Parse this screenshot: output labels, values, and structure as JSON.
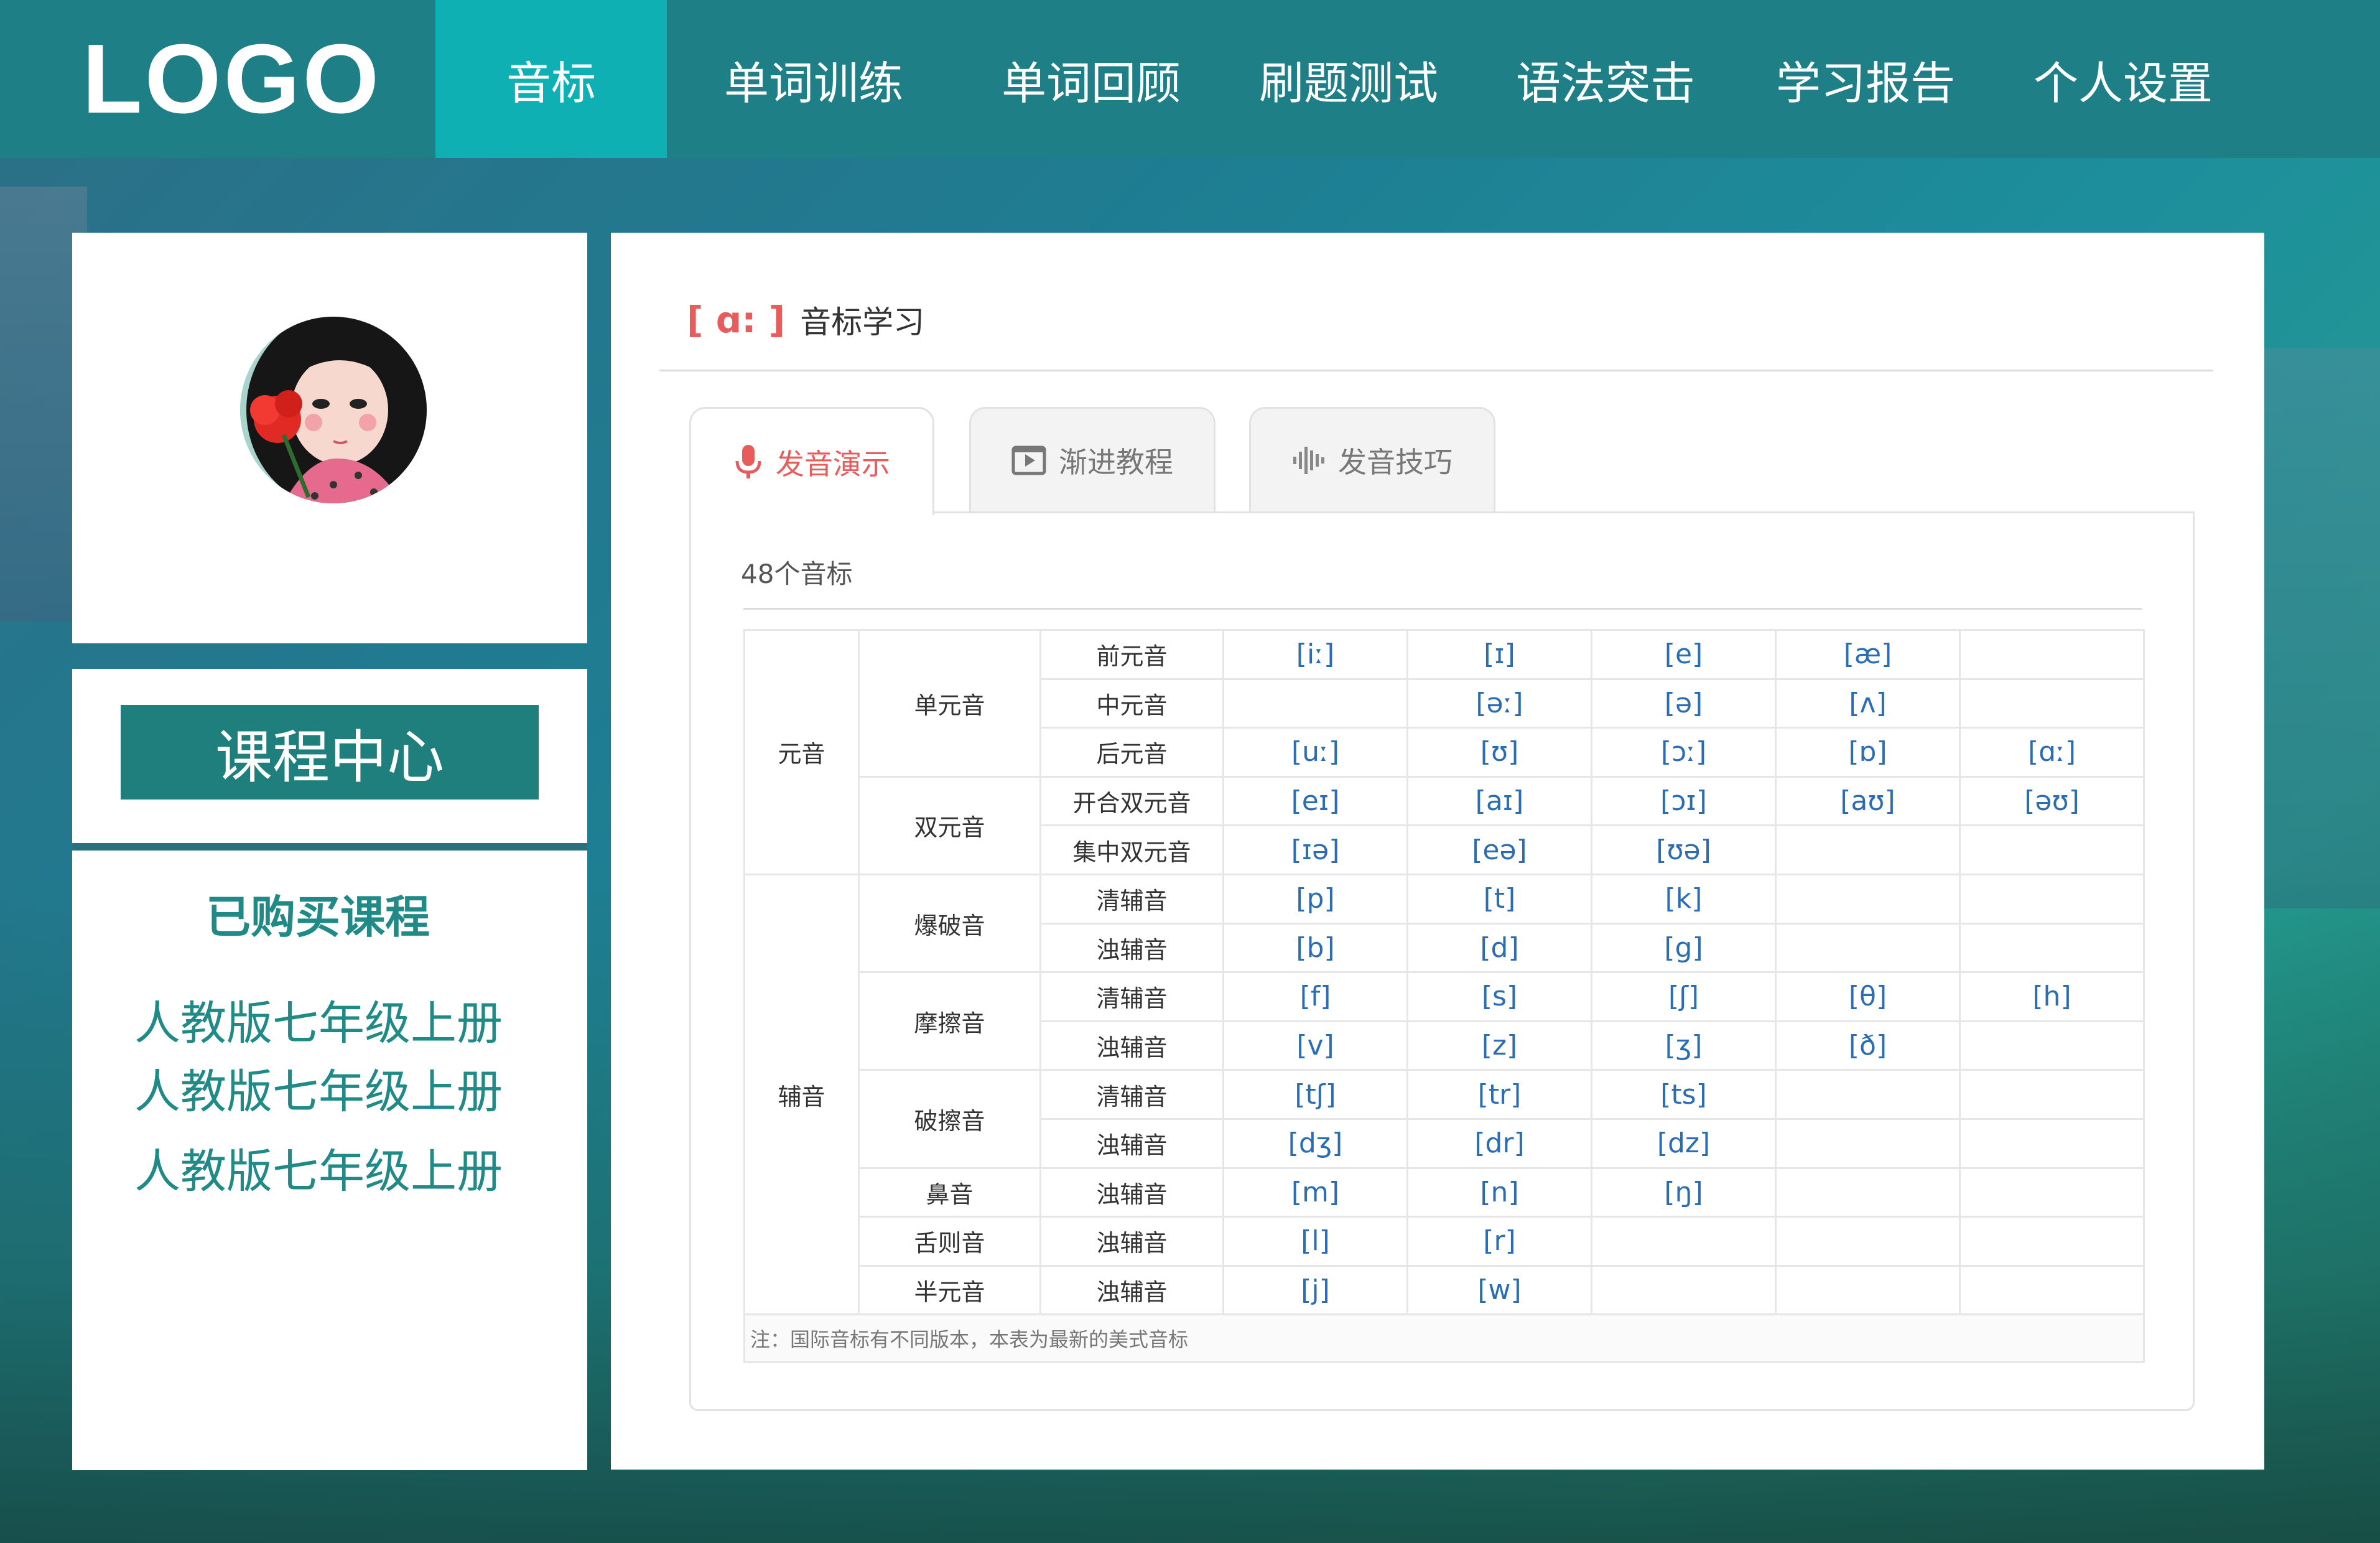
{
  "logo": "LOGO",
  "nav": [
    {
      "label": "音标",
      "active": true
    },
    {
      "label": "单词训练"
    },
    {
      "label": "单词回顾"
    },
    {
      "label": "刷题测试"
    },
    {
      "label": "语法突击"
    },
    {
      "label": "学习报告"
    },
    {
      "label": "个人设置"
    }
  ],
  "sidebar": {
    "course_center": "课程中心",
    "purchased_title": "已购买课程",
    "courses": [
      "人教版七年级上册",
      "人教版七年级上册",
      "人教版七年级上册"
    ]
  },
  "main": {
    "section_icon": "[ ɑ: ]",
    "section_title": "音标学习",
    "tabs": [
      {
        "label": "发音演示",
        "icon": "microphone-icon",
        "active": true
      },
      {
        "label": "渐进教程",
        "icon": "video-icon"
      },
      {
        "label": "发音技巧",
        "icon": "soundwave-icon"
      }
    ],
    "count_label": "48个音标",
    "table": {
      "vowel": "元音",
      "consonant": "辅音",
      "groups": {
        "monophthong": "单元音",
        "diphthong": "双元音",
        "plosive": "爆破音",
        "fricative": "摩擦音",
        "affricate": "破擦音",
        "nasal": "鼻音",
        "lateral": "舌则音",
        "semivowel": "半元音"
      },
      "rows": [
        {
          "sub": "前元音",
          "symbols": [
            "[iː]",
            "[ɪ]",
            "[e]",
            "[æ]",
            ""
          ]
        },
        {
          "sub": "中元音",
          "symbols": [
            "",
            "[əː]",
            "[ə]",
            "[ʌ]",
            ""
          ]
        },
        {
          "sub": "后元音",
          "symbols": [
            "[uː]",
            "[ʊ]",
            "[ɔː]",
            "[ɒ]",
            "[ɑː]"
          ]
        },
        {
          "sub": "开合双元音",
          "symbols": [
            "[eɪ]",
            "[aɪ]",
            "[ɔɪ]",
            "[aʊ]",
            "[əʊ]"
          ]
        },
        {
          "sub": "集中双元音",
          "symbols": [
            "[ɪə]",
            "[eə]",
            "[ʊə]",
            "",
            ""
          ]
        },
        {
          "sub": "清辅音",
          "symbols": [
            "[p]",
            "[t]",
            "[k]",
            "",
            ""
          ]
        },
        {
          "sub": "浊辅音",
          "symbols": [
            "[b]",
            "[d]",
            "[g]",
            "",
            ""
          ]
        },
        {
          "sub": "清辅音",
          "symbols": [
            "[f]",
            "[s]",
            "[ʃ]",
            "[θ]",
            "[h]"
          ]
        },
        {
          "sub": "浊辅音",
          "symbols": [
            "[v]",
            "[z]",
            "[ʒ]",
            "[ð]",
            ""
          ]
        },
        {
          "sub": "清辅音",
          "symbols": [
            "[tʃ]",
            "[tr]",
            "[ts]",
            "",
            ""
          ]
        },
        {
          "sub": "浊辅音",
          "symbols": [
            "[dʒ]",
            "[dr]",
            "[dz]",
            "",
            ""
          ]
        },
        {
          "sub": "浊辅音",
          "symbols": [
            "[m]",
            "[n]",
            "[ŋ]",
            "",
            ""
          ]
        },
        {
          "sub": "浊辅音",
          "symbols": [
            "[l]",
            "[r]",
            "",
            "",
            ""
          ]
        },
        {
          "sub": "浊辅音",
          "symbols": [
            "[j]",
            "[w]",
            "",
            "",
            ""
          ]
        }
      ],
      "note": "注：国际音标有不同版本，本表为最新的美式音标"
    }
  },
  "colors": {
    "header": "#1f7f86",
    "nav_active": "#0fb0b4",
    "accent_red": "#e85c5c",
    "teal_text": "#1f8a86"
  }
}
